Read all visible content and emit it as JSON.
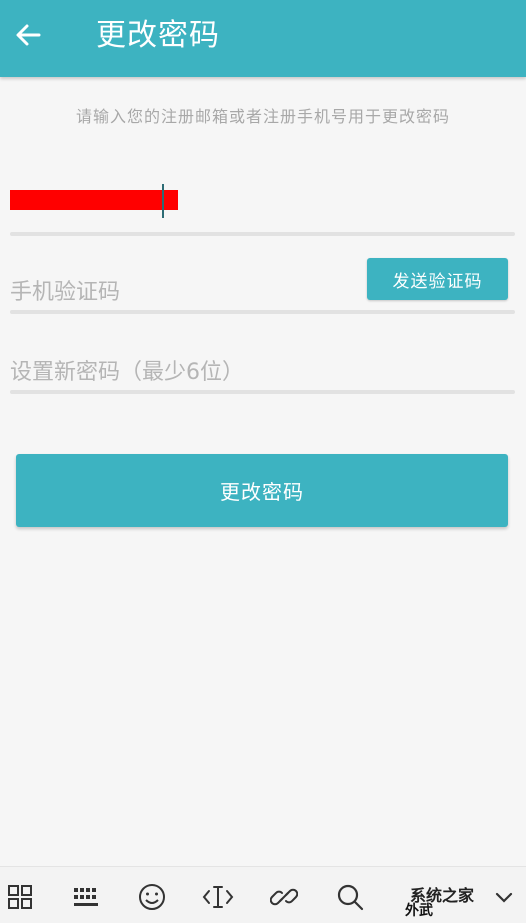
{
  "header": {
    "title": "更改密码",
    "back_icon": "arrow-left-icon",
    "color": "#3db3c1"
  },
  "hint_text": "请输入您的注册邮箱或者注册手机号用于更改密码",
  "form": {
    "account_value": "",
    "code_placeholder": "手机验证码",
    "send_code_label": "发送验证码",
    "password_placeholder": "设置新密码（最少6位）"
  },
  "submit_label": "更改密码",
  "keyboard_toolbar": {
    "icons": [
      "grid-icon",
      "keyboard-icon",
      "emoji-icon",
      "cursor-move-icon",
      "link-icon",
      "search-icon",
      "chevron-down-icon"
    ],
    "watermark": "系统之家",
    "watermark_small": "外武"
  }
}
